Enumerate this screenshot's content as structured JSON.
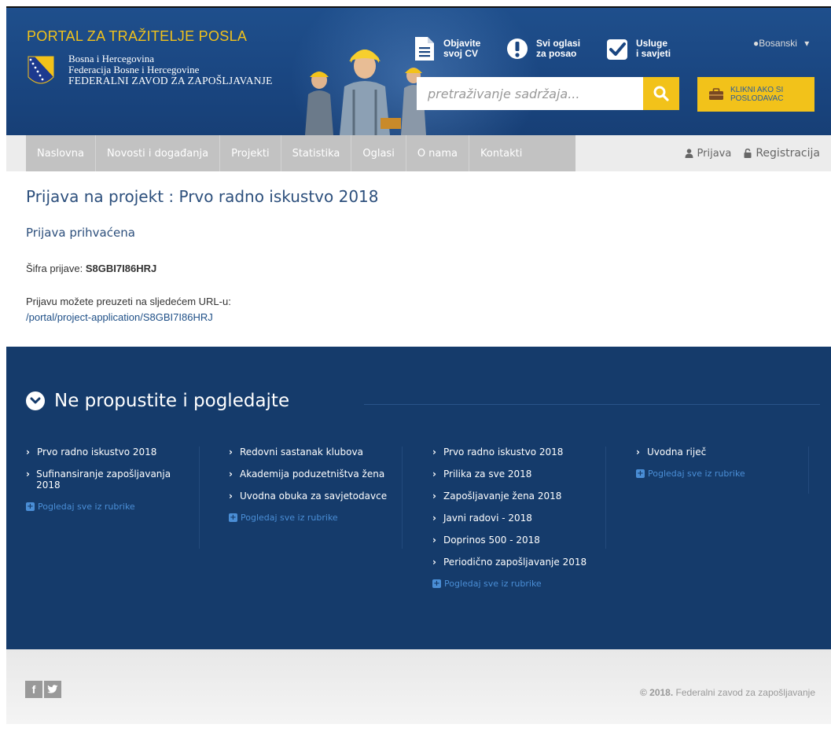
{
  "header": {
    "portal_title": "PORTAL ZA TRAŽITELJE POSLA",
    "org_line1": "Bosna i Hercegovina",
    "org_line2": "Federacija Bosne i Hercegovine",
    "org_line3": "FEDERALNI ZAVOD ZA ZAPOŠLJAVANJE",
    "quick_links": [
      {
        "line1": "Objavite",
        "line2": "svoj CV",
        "icon": "document-icon"
      },
      {
        "line1": "Svi oglasi",
        "line2": "za posao",
        "icon": "exclamation-icon"
      },
      {
        "line1": "Usluge",
        "line2": "i savjeti",
        "icon": "checkmark-icon"
      }
    ],
    "language": "Bosanski",
    "search_placeholder": "pretraživanje sadržaja...",
    "employer_line1": "KLIKNI AKO SI",
    "employer_line2": "POSLODAVAC"
  },
  "nav": {
    "items": [
      "Naslovna",
      "Novosti i događanja",
      "Projekti",
      "Statistika",
      "Oglasi",
      "O nama",
      "Kontakti"
    ],
    "login": "Prijava",
    "register": "Registracija"
  },
  "content": {
    "title": "Prijava na projekt : Prvo radno iskustvo 2018",
    "subtitle": "Prijava prihvaćena",
    "code_label": "Šifra prijave:",
    "code_value": "S8GBI7I86HRJ",
    "url_label": "Prijavu možete preuzeti na sljedećem URL-u:",
    "url_value": "/portal/project-application/S8GBI7I86HRJ"
  },
  "related": {
    "heading": "Ne propustite i pogledajte",
    "more_label": "Pogledaj sve iz rubrike",
    "columns": [
      {
        "items": [
          "Prvo radno iskustvo 2018",
          "Sufinansiranje zapošljavanja 2018"
        ]
      },
      {
        "items": [
          "Redovni sastanak klubova",
          "Akademija poduzetništva žena",
          "Uvodna obuka za savjetodavce"
        ]
      },
      {
        "items": [
          "Prvo radno iskustvo 2018",
          "Prilika za sve 2018",
          "Zapošljavanje žena 2018",
          "Javni radovi - 2018",
          "Doprinos 500 - 2018",
          "Periodično zapošljavanje 2018"
        ]
      },
      {
        "items": [
          "Uvodna riječ"
        ]
      }
    ]
  },
  "footer": {
    "year": "© 2018.",
    "org": "Federalni zavod za zapošljavanje",
    "social": [
      "f",
      "t"
    ]
  },
  "colors": {
    "header_blue": "#1a4681",
    "accent_yellow": "#f2c21a",
    "section_navy": "#153b6b",
    "link_blue": "#4a8ed6"
  }
}
